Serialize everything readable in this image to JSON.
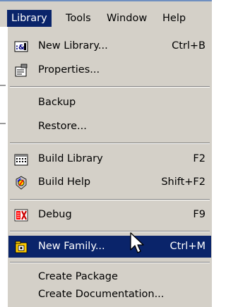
{
  "menubar": {
    "items": [
      {
        "label": "Library"
      },
      {
        "label": "Tools"
      },
      {
        "label": "Window"
      },
      {
        "label": "Help"
      }
    ]
  },
  "menu": {
    "new_library": {
      "label": "New Library...",
      "accel": "Ctrl+B"
    },
    "properties": {
      "label": "Properties..."
    },
    "backup": {
      "label": "Backup"
    },
    "restore": {
      "label": "Restore..."
    },
    "build_library": {
      "label": "Build Library",
      "accel": "F2"
    },
    "build_help": {
      "label": "Build Help",
      "accel": "Shift+F2"
    },
    "debug": {
      "label": "Debug",
      "accel": "F9"
    },
    "new_family": {
      "label": "New Family...",
      "accel": "Ctrl+M"
    },
    "create_package": {
      "label": "Create Package"
    },
    "create_documentation": {
      "label": "Create Documentation..."
    }
  },
  "colors": {
    "menu_bg": "#d4d0c8",
    "highlight": "#0a246a"
  }
}
